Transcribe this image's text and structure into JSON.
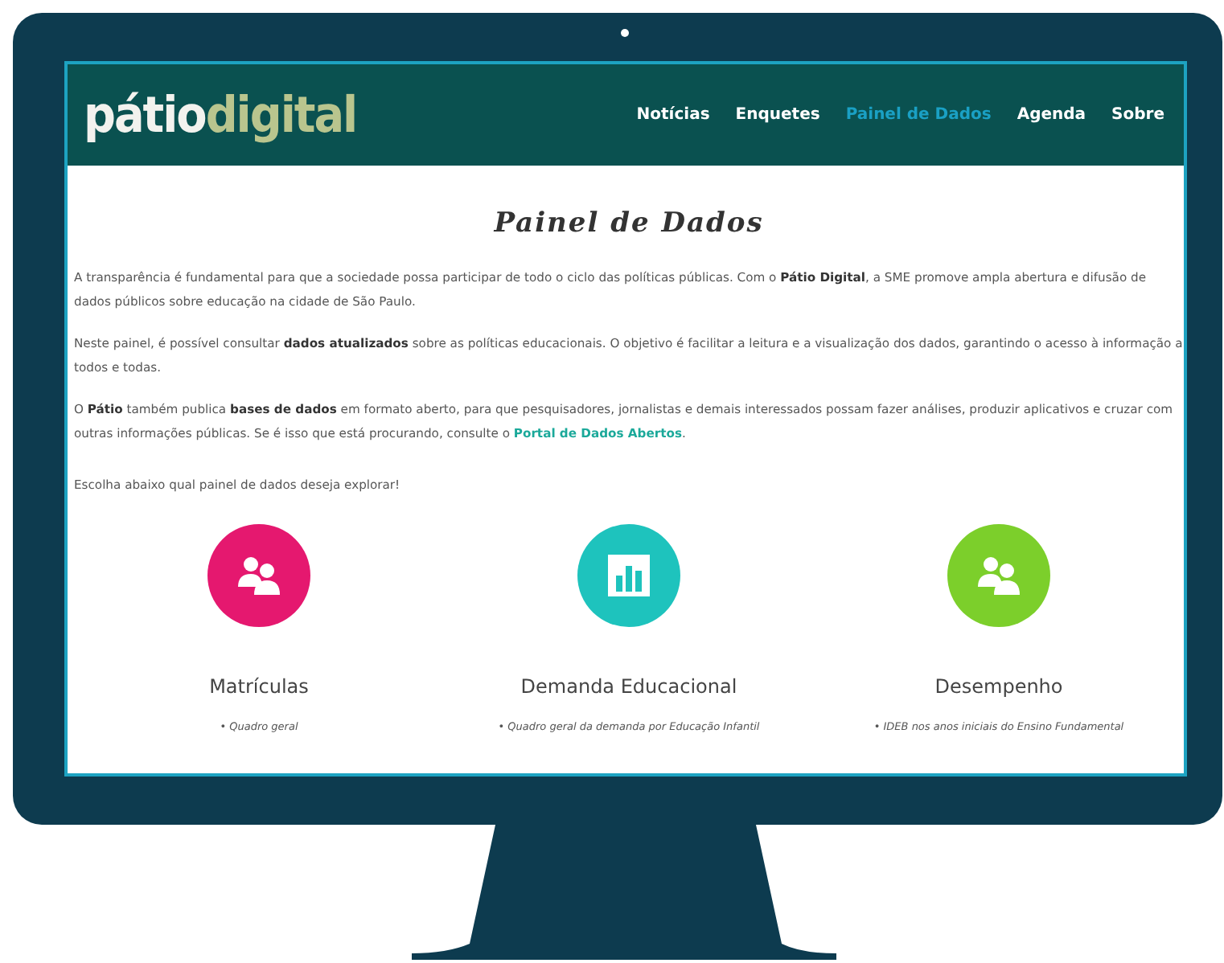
{
  "header": {
    "logo": {
      "first": "pátio",
      "second": "digital"
    },
    "nav": [
      {
        "label": "Notícias",
        "selected": false
      },
      {
        "label": "Enquetes",
        "selected": false
      },
      {
        "label": "Painel de Dados",
        "selected": true
      },
      {
        "label": "Agenda",
        "selected": false
      },
      {
        "label": "Sobre",
        "selected": false
      }
    ]
  },
  "title": "Painel de Dados",
  "paragraphs": [
    {
      "text": "A transparência é fundamental para que a sociedade possa participar de todo o ciclo das políticas públicas. Com o **Pátio Digital**, a SME promove ampla abertura e difusão de dados públicos sobre educação na cidade de São Paulo."
    },
    {
      "text": "Neste painel, é possível consultar **dados atualizados** sobre as políticas educacionais. O objetivo é facilitar a leitura e a visualização dos dados, garantindo o acesso à informação a todos e todas."
    },
    {
      "text": "O **Pátio** também publica **bases de dados** em formato aberto, para que pesquisadores, jornalistas e demais interessados possam fazer análises, produzir aplicativos e cruzar com outras informações públicas. Se é isso que está procurando, consulte o ",
      "link": "Portal de Dados Abertos",
      "after": "."
    }
  ],
  "prompt": "Escolha abaixo qual painel de dados deseja explorar!",
  "panels": [
    {
      "kind": "people",
      "color": "#e5186f",
      "title": "Matrículas",
      "items": [
        "• Quadro geral"
      ]
    },
    {
      "kind": "chart",
      "color": "#1ec3bd",
      "title": "Demanda Educacional",
      "items": [
        "• Quadro geral da demanda por Educação Infantil"
      ]
    },
    {
      "kind": "people",
      "color": "#7ccf2b",
      "title": "Desempenho",
      "items": [
        "• IDEB nos anos iniciais do Ensino Fundamental"
      ]
    }
  ]
}
